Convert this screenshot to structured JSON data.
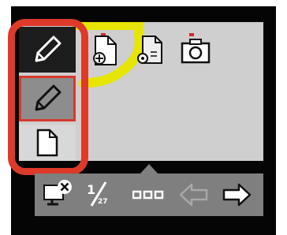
{
  "colors": {
    "frame_red": "#dd3a2a",
    "canvas_gray": "#cfcfcf",
    "toolbar_gray": "#7f7f7f",
    "device_black": "#050505",
    "highlight_yellow": "#e6e600"
  },
  "side_tools": [
    {
      "name": "pen-tool",
      "icon": "pencil-icon",
      "state": "dark"
    },
    {
      "name": "pen-tool-selected",
      "icon": "pencil-icon",
      "state": "selected"
    },
    {
      "name": "page-tool",
      "icon": "page-icon",
      "state": "light"
    }
  ],
  "top_icons": [
    {
      "name": "new-page",
      "icon": "new-page-icon"
    },
    {
      "name": "page-settings",
      "icon": "page-settings-icon"
    },
    {
      "name": "camera",
      "icon": "camera-icon"
    }
  ],
  "toolbar": {
    "monitor_icon": "monitor-close-icon",
    "page_current": "1",
    "page_total": "27",
    "more_icon": "more-dots-icon",
    "back_icon": "arrow-left-icon",
    "forward_icon": "arrow-right-icon"
  }
}
